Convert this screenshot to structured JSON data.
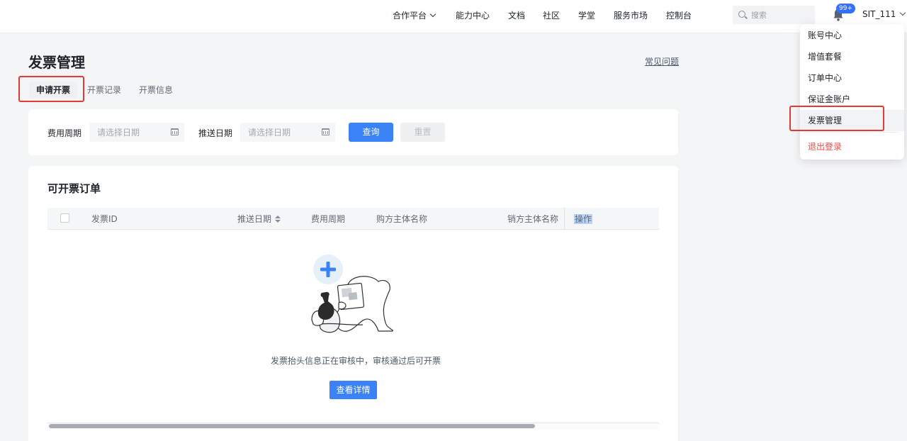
{
  "topnav": {
    "items": [
      "合作平台",
      "能力中心",
      "文档",
      "社区",
      "学堂",
      "服务市场",
      "控制台"
    ],
    "search_placeholder": "搜索",
    "notification_badge": "99+",
    "username": "SIT_111"
  },
  "user_menu": {
    "items": [
      "账号中心",
      "增值套餐",
      "订单中心",
      "保证金账户",
      "发票管理"
    ],
    "logout": "退出登录"
  },
  "page": {
    "title": "发票管理",
    "faq_link": "常见问题",
    "tabs": [
      "申请开票",
      "开票记录",
      "开票信息"
    ]
  },
  "filter": {
    "fee_period_label": "费用周期",
    "fee_period_placeholder": "请选择日期",
    "push_date_label": "推送日期",
    "push_date_placeholder": "请选择日期",
    "query_button": "查询",
    "reset_button": "重置"
  },
  "orders": {
    "title": "可开票订单",
    "columns": [
      "发票ID",
      "推送日期",
      "费用周期",
      "购方主体名称",
      "销方主体名称",
      "操作"
    ],
    "empty_text": "发票抬头信息正在审核中，审核通过后可开票",
    "detail_button": "查看详情"
  },
  "colors": {
    "primary": "#3b82f6",
    "highlight_box": "#e53935",
    "logout_text": "#f54a45"
  }
}
